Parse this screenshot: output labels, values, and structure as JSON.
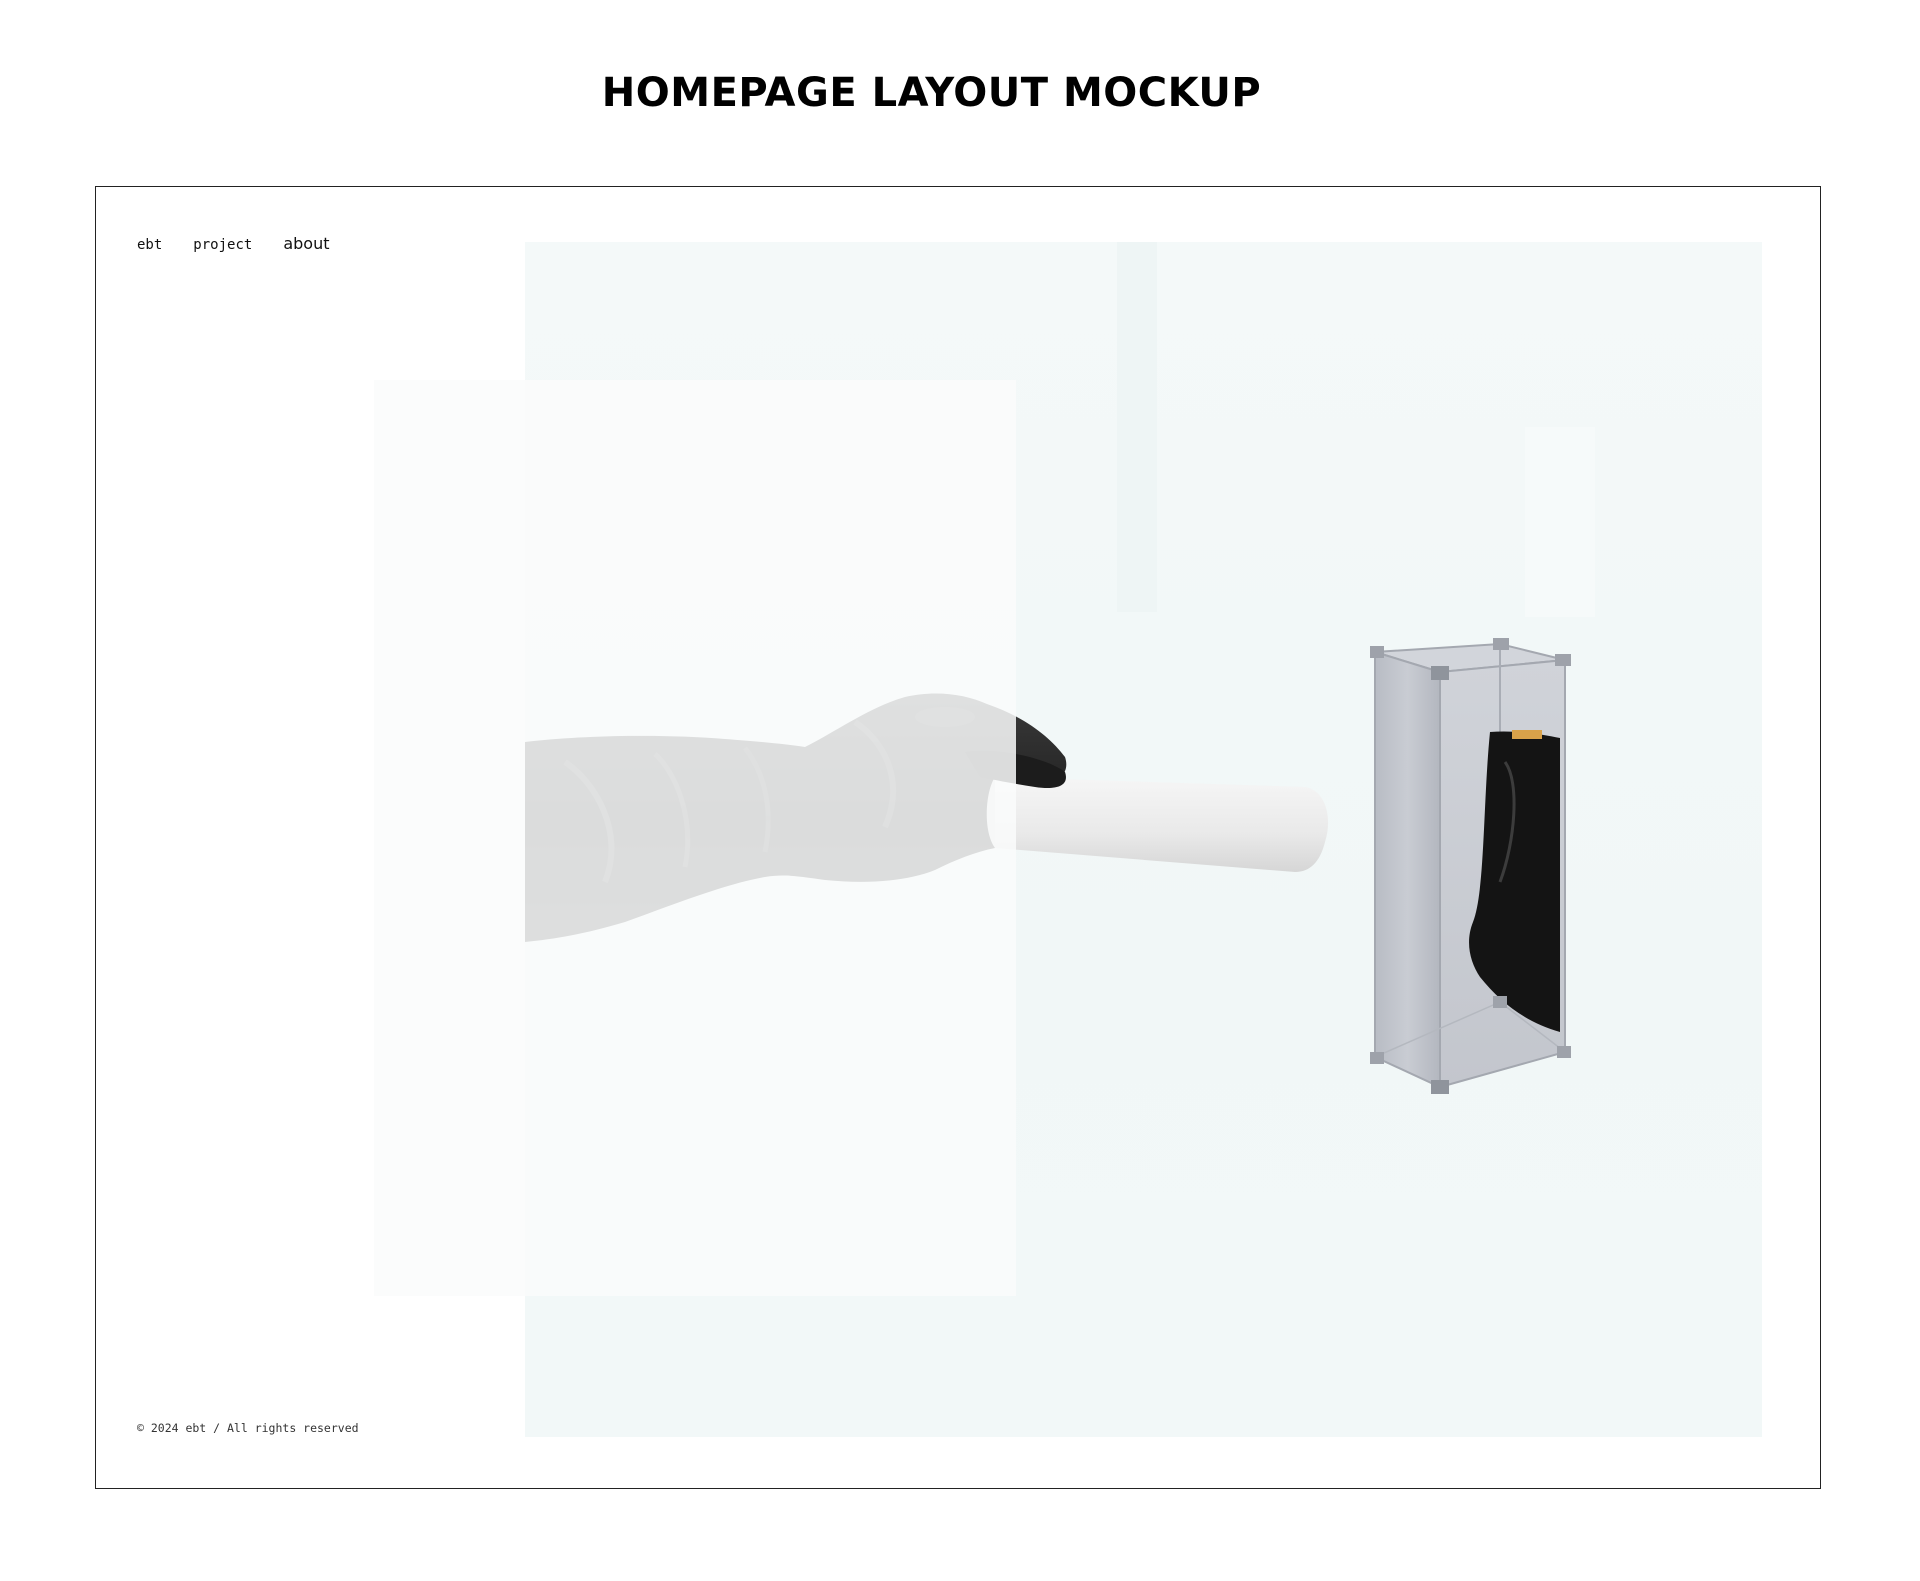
{
  "page": {
    "title": "HOMEPAGE LAYOUT MOCKUP"
  },
  "site": {
    "nav": {
      "brand": "ebt",
      "project": "project",
      "about": "about"
    },
    "footer": {
      "copyright": "© 2024 ebt / All rights reserved"
    }
  },
  "hero": {
    "image_subject": "gloved-hand-reaching-toward-acrylic-display-box",
    "colors": {
      "background": "#f2f8f8",
      "glove": "#2b2b2b",
      "acrylic": "#c9ccd2",
      "panel": "#fafbfb"
    }
  }
}
